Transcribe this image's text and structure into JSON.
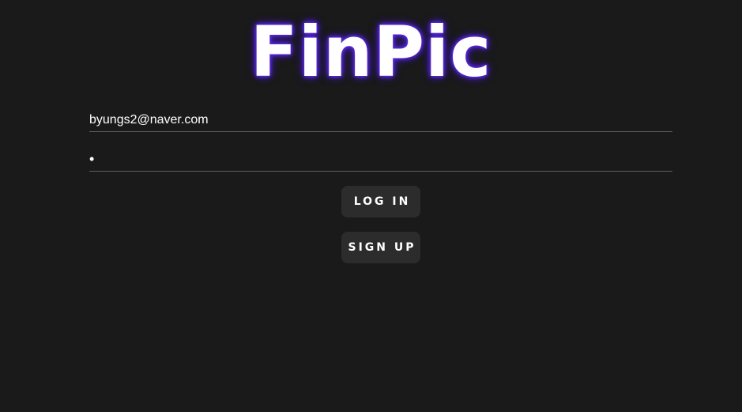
{
  "app": {
    "title": "FinPic"
  },
  "form": {
    "email_value": "byungs2@naver.com",
    "password_value": "•"
  },
  "buttons": {
    "login_label": "LOG IN",
    "signup_label": "SIGN UP"
  },
  "colors": {
    "background": "#1a1a1a",
    "logo_glow": "#5b2be0",
    "button_bg": "#2c2c2c",
    "underline": "#5e5e5e",
    "text": "#ffffff"
  }
}
